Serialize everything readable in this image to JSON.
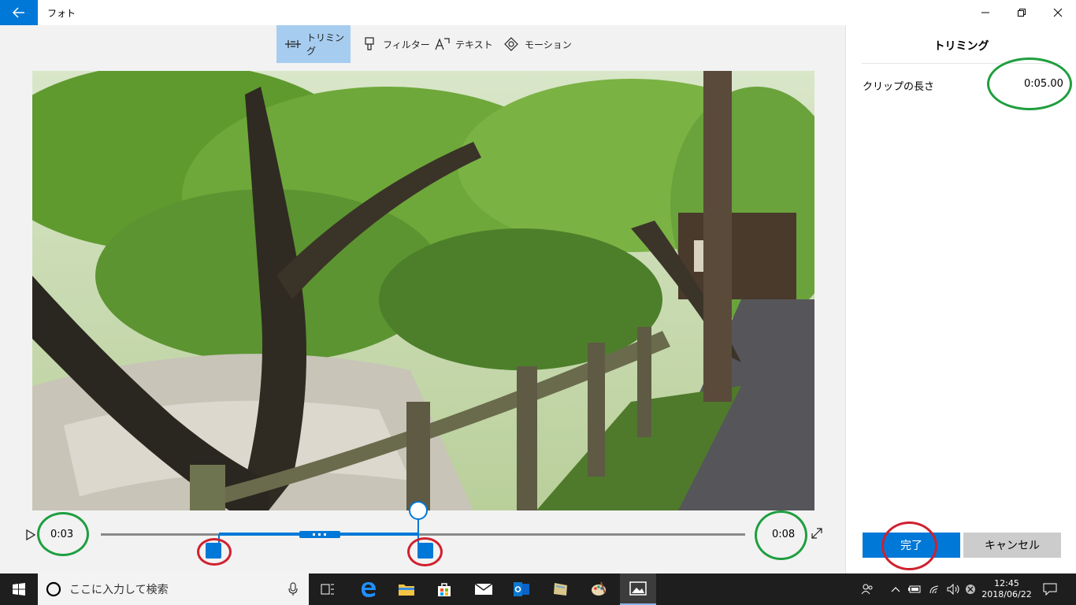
{
  "window": {
    "app_title": "フォト"
  },
  "toolbar": {
    "tabs": [
      {
        "label": "トリミング",
        "icon": "trim-icon",
        "active": true
      },
      {
        "label": "フィルター",
        "icon": "brush-icon",
        "active": false
      },
      {
        "label": "テキスト",
        "icon": "text-icon",
        "active": false
      },
      {
        "label": "モーション",
        "icon": "motion-icon",
        "active": false
      }
    ]
  },
  "timeline": {
    "start_time": "0:03",
    "end_time": "0:08"
  },
  "panel": {
    "title": "トリミング",
    "clip_length_label": "クリップの長さ",
    "clip_length_value": "0:05.00",
    "done_label": "完了",
    "cancel_label": "キャンセル"
  },
  "taskbar": {
    "search_placeholder": "ここに入力して検索",
    "time": "12:45",
    "date": "2018/06/22"
  },
  "colors": {
    "accent": "#0078d7",
    "annotation_green": "#1f9e3f",
    "annotation_red": "#d0202e"
  }
}
